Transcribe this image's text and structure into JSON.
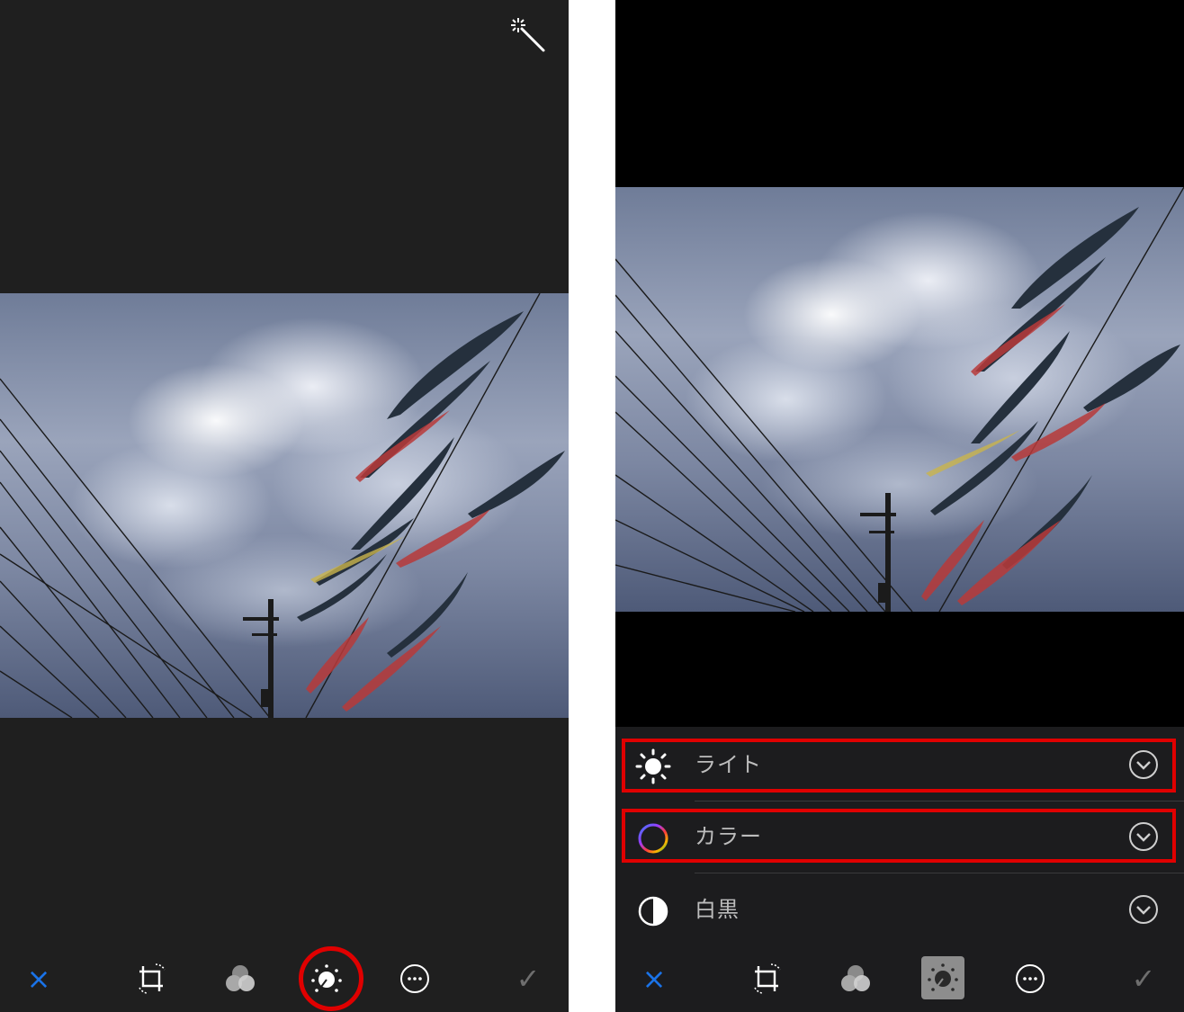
{
  "left_screen": {
    "toolbar": {
      "cancel_symbol": "×",
      "done_symbol": "✓",
      "icons": [
        "crop-rotate-icon",
        "filters-icon",
        "adjust-dial-icon",
        "more-options-icon"
      ]
    },
    "highlight_color": "#e00000",
    "top_icon": "magic-wand-icon"
  },
  "right_screen": {
    "adjust_menu": {
      "rows": [
        {
          "label": "ライト",
          "icon": "sun-icon"
        },
        {
          "label": "カラー",
          "icon": "color-ring-icon"
        },
        {
          "label": "白黒",
          "icon": "half-circle-icon"
        }
      ]
    },
    "toolbar": {
      "cancel_symbol": "×",
      "done_symbol": "✓",
      "icons": [
        "crop-rotate-icon",
        "filters-icon",
        "adjust-dial-icon",
        "more-options-icon"
      ]
    },
    "highlight_color": "#e00000"
  },
  "colors": {
    "cancel_blue": "#1a73e8",
    "panel_dark": "#1f1f1f",
    "menu_bg": "#1c1c1e"
  }
}
